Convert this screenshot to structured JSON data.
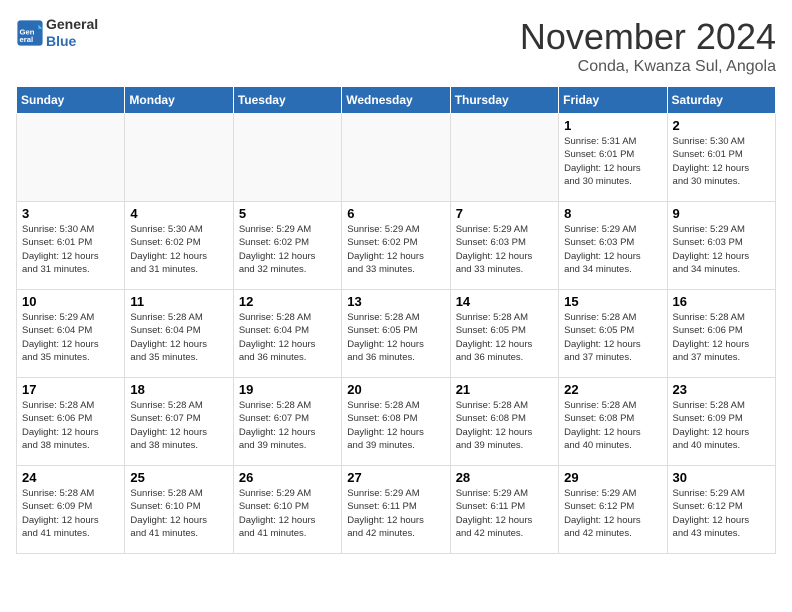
{
  "header": {
    "logo_line1": "General",
    "logo_line2": "Blue",
    "month": "November 2024",
    "location": "Conda, Kwanza Sul, Angola"
  },
  "days_of_week": [
    "Sunday",
    "Monday",
    "Tuesday",
    "Wednesday",
    "Thursday",
    "Friday",
    "Saturday"
  ],
  "weeks": [
    [
      {
        "day": "",
        "info": ""
      },
      {
        "day": "",
        "info": ""
      },
      {
        "day": "",
        "info": ""
      },
      {
        "day": "",
        "info": ""
      },
      {
        "day": "",
        "info": ""
      },
      {
        "day": "1",
        "info": "Sunrise: 5:31 AM\nSunset: 6:01 PM\nDaylight: 12 hours\nand 30 minutes."
      },
      {
        "day": "2",
        "info": "Sunrise: 5:30 AM\nSunset: 6:01 PM\nDaylight: 12 hours\nand 30 minutes."
      }
    ],
    [
      {
        "day": "3",
        "info": "Sunrise: 5:30 AM\nSunset: 6:01 PM\nDaylight: 12 hours\nand 31 minutes."
      },
      {
        "day": "4",
        "info": "Sunrise: 5:30 AM\nSunset: 6:02 PM\nDaylight: 12 hours\nand 31 minutes."
      },
      {
        "day": "5",
        "info": "Sunrise: 5:29 AM\nSunset: 6:02 PM\nDaylight: 12 hours\nand 32 minutes."
      },
      {
        "day": "6",
        "info": "Sunrise: 5:29 AM\nSunset: 6:02 PM\nDaylight: 12 hours\nand 33 minutes."
      },
      {
        "day": "7",
        "info": "Sunrise: 5:29 AM\nSunset: 6:03 PM\nDaylight: 12 hours\nand 33 minutes."
      },
      {
        "day": "8",
        "info": "Sunrise: 5:29 AM\nSunset: 6:03 PM\nDaylight: 12 hours\nand 34 minutes."
      },
      {
        "day": "9",
        "info": "Sunrise: 5:29 AM\nSunset: 6:03 PM\nDaylight: 12 hours\nand 34 minutes."
      }
    ],
    [
      {
        "day": "10",
        "info": "Sunrise: 5:29 AM\nSunset: 6:04 PM\nDaylight: 12 hours\nand 35 minutes."
      },
      {
        "day": "11",
        "info": "Sunrise: 5:28 AM\nSunset: 6:04 PM\nDaylight: 12 hours\nand 35 minutes."
      },
      {
        "day": "12",
        "info": "Sunrise: 5:28 AM\nSunset: 6:04 PM\nDaylight: 12 hours\nand 36 minutes."
      },
      {
        "day": "13",
        "info": "Sunrise: 5:28 AM\nSunset: 6:05 PM\nDaylight: 12 hours\nand 36 minutes."
      },
      {
        "day": "14",
        "info": "Sunrise: 5:28 AM\nSunset: 6:05 PM\nDaylight: 12 hours\nand 36 minutes."
      },
      {
        "day": "15",
        "info": "Sunrise: 5:28 AM\nSunset: 6:05 PM\nDaylight: 12 hours\nand 37 minutes."
      },
      {
        "day": "16",
        "info": "Sunrise: 5:28 AM\nSunset: 6:06 PM\nDaylight: 12 hours\nand 37 minutes."
      }
    ],
    [
      {
        "day": "17",
        "info": "Sunrise: 5:28 AM\nSunset: 6:06 PM\nDaylight: 12 hours\nand 38 minutes."
      },
      {
        "day": "18",
        "info": "Sunrise: 5:28 AM\nSunset: 6:07 PM\nDaylight: 12 hours\nand 38 minutes."
      },
      {
        "day": "19",
        "info": "Sunrise: 5:28 AM\nSunset: 6:07 PM\nDaylight: 12 hours\nand 39 minutes."
      },
      {
        "day": "20",
        "info": "Sunrise: 5:28 AM\nSunset: 6:08 PM\nDaylight: 12 hours\nand 39 minutes."
      },
      {
        "day": "21",
        "info": "Sunrise: 5:28 AM\nSunset: 6:08 PM\nDaylight: 12 hours\nand 39 minutes."
      },
      {
        "day": "22",
        "info": "Sunrise: 5:28 AM\nSunset: 6:08 PM\nDaylight: 12 hours\nand 40 minutes."
      },
      {
        "day": "23",
        "info": "Sunrise: 5:28 AM\nSunset: 6:09 PM\nDaylight: 12 hours\nand 40 minutes."
      }
    ],
    [
      {
        "day": "24",
        "info": "Sunrise: 5:28 AM\nSunset: 6:09 PM\nDaylight: 12 hours\nand 41 minutes."
      },
      {
        "day": "25",
        "info": "Sunrise: 5:28 AM\nSunset: 6:10 PM\nDaylight: 12 hours\nand 41 minutes."
      },
      {
        "day": "26",
        "info": "Sunrise: 5:29 AM\nSunset: 6:10 PM\nDaylight: 12 hours\nand 41 minutes."
      },
      {
        "day": "27",
        "info": "Sunrise: 5:29 AM\nSunset: 6:11 PM\nDaylight: 12 hours\nand 42 minutes."
      },
      {
        "day": "28",
        "info": "Sunrise: 5:29 AM\nSunset: 6:11 PM\nDaylight: 12 hours\nand 42 minutes."
      },
      {
        "day": "29",
        "info": "Sunrise: 5:29 AM\nSunset: 6:12 PM\nDaylight: 12 hours\nand 42 minutes."
      },
      {
        "day": "30",
        "info": "Sunrise: 5:29 AM\nSunset: 6:12 PM\nDaylight: 12 hours\nand 43 minutes."
      }
    ]
  ]
}
